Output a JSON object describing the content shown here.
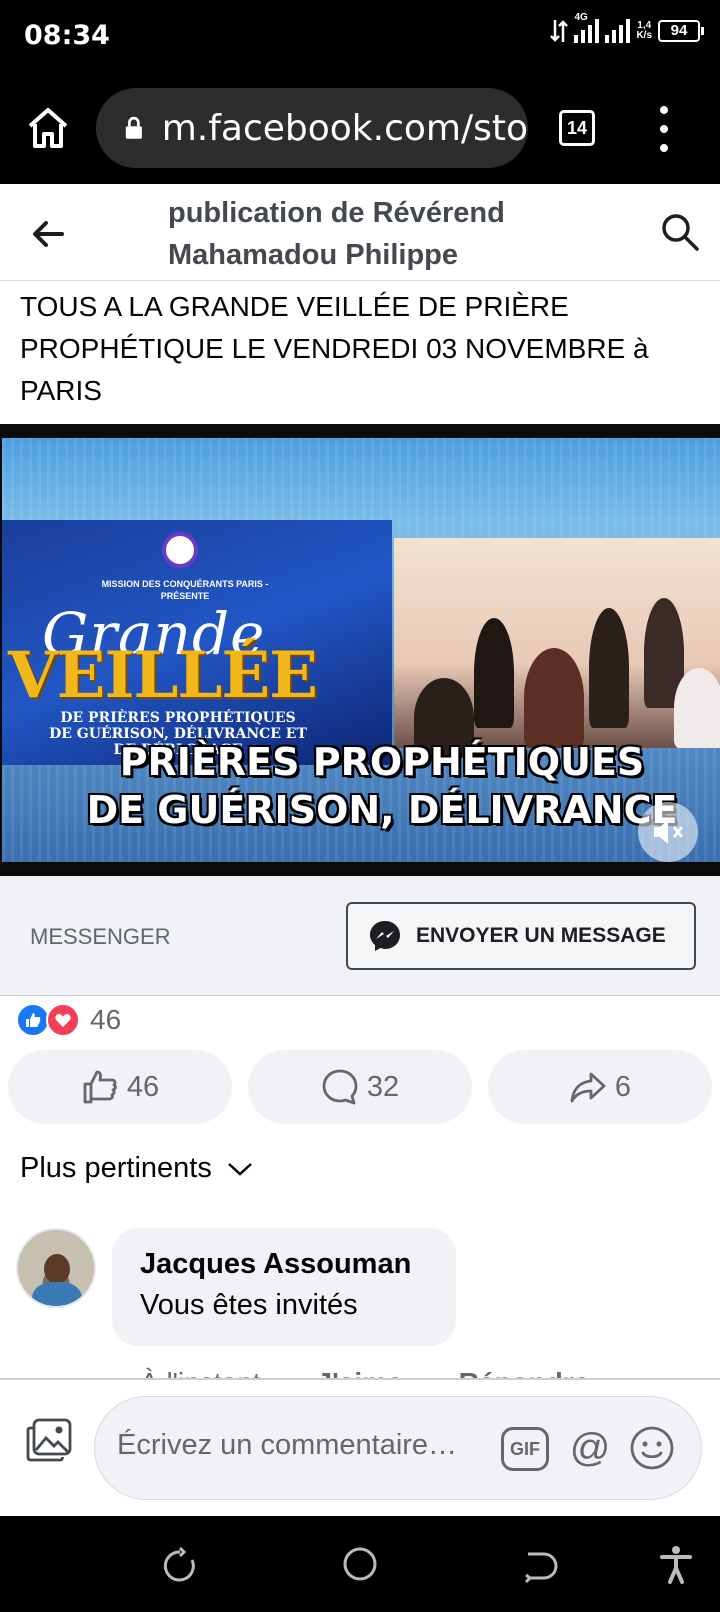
{
  "status_bar": {
    "time": "08:34",
    "network": "4G",
    "speed_value": "1,4",
    "speed_unit": "K/s",
    "battery": "94"
  },
  "browser": {
    "url": "m.facebook.com/sto",
    "tab_count": "14"
  },
  "header": {
    "title": "publication de Révérend Mahamadou Philippe"
  },
  "post": {
    "text": "TOUS A LA GRANDE VEILLÉE DE PRIÈRE PROPHÉTIQUE LE VENDREDI 03 NOVEMBRE à PARIS",
    "video": {
      "poster_mission": "MISSION DES CONQUÉRANTS PARIS - PRÉSENTE",
      "poster_grande": "Grande",
      "poster_veillee": "VEILLÉE",
      "poster_sub": "DE PRIÈRES PROPHÉTIQUES DE GUÉRISON, DÉLIVRANCE ET DE DÉBLOCAGE",
      "banner_line1": "PRIÈRES PROPHÉTIQUES",
      "banner_line2": "DE GUÉRISON, DÉLIVRANCE"
    }
  },
  "messenger": {
    "label": "MESSENGER",
    "button_label": "ENVOYER UN MESSAGE"
  },
  "reactions": {
    "total": "46",
    "likes": "46",
    "comments": "32",
    "shares": "6"
  },
  "sort": {
    "label": "Plus pertinents"
  },
  "comment": {
    "author": "Jacques Assouman",
    "text": "Vous êtes invités",
    "time": "À l'instant",
    "like_label": "J'aime",
    "reply_label": "Répondre"
  },
  "composer": {
    "placeholder": "Écrivez un commentaire…",
    "gif_label": "GIF",
    "at_label": "@"
  },
  "colors": {
    "facebook_blue": "#1877f2",
    "love_red": "#f33e58",
    "grey_text": "#65676b",
    "surface": "#f0f2f5"
  },
  "icons": [
    "home-icon",
    "lock-icon",
    "tabs-icon",
    "more-icon",
    "back-arrow-icon",
    "search-icon",
    "mute-icon",
    "messenger-icon",
    "like-icon",
    "love-icon",
    "comment-icon",
    "share-icon",
    "chevron-down-icon",
    "photo-icon",
    "emoji-icon",
    "recent-apps-icon",
    "nav-home-icon",
    "nav-back-icon",
    "accessibility-icon"
  ]
}
